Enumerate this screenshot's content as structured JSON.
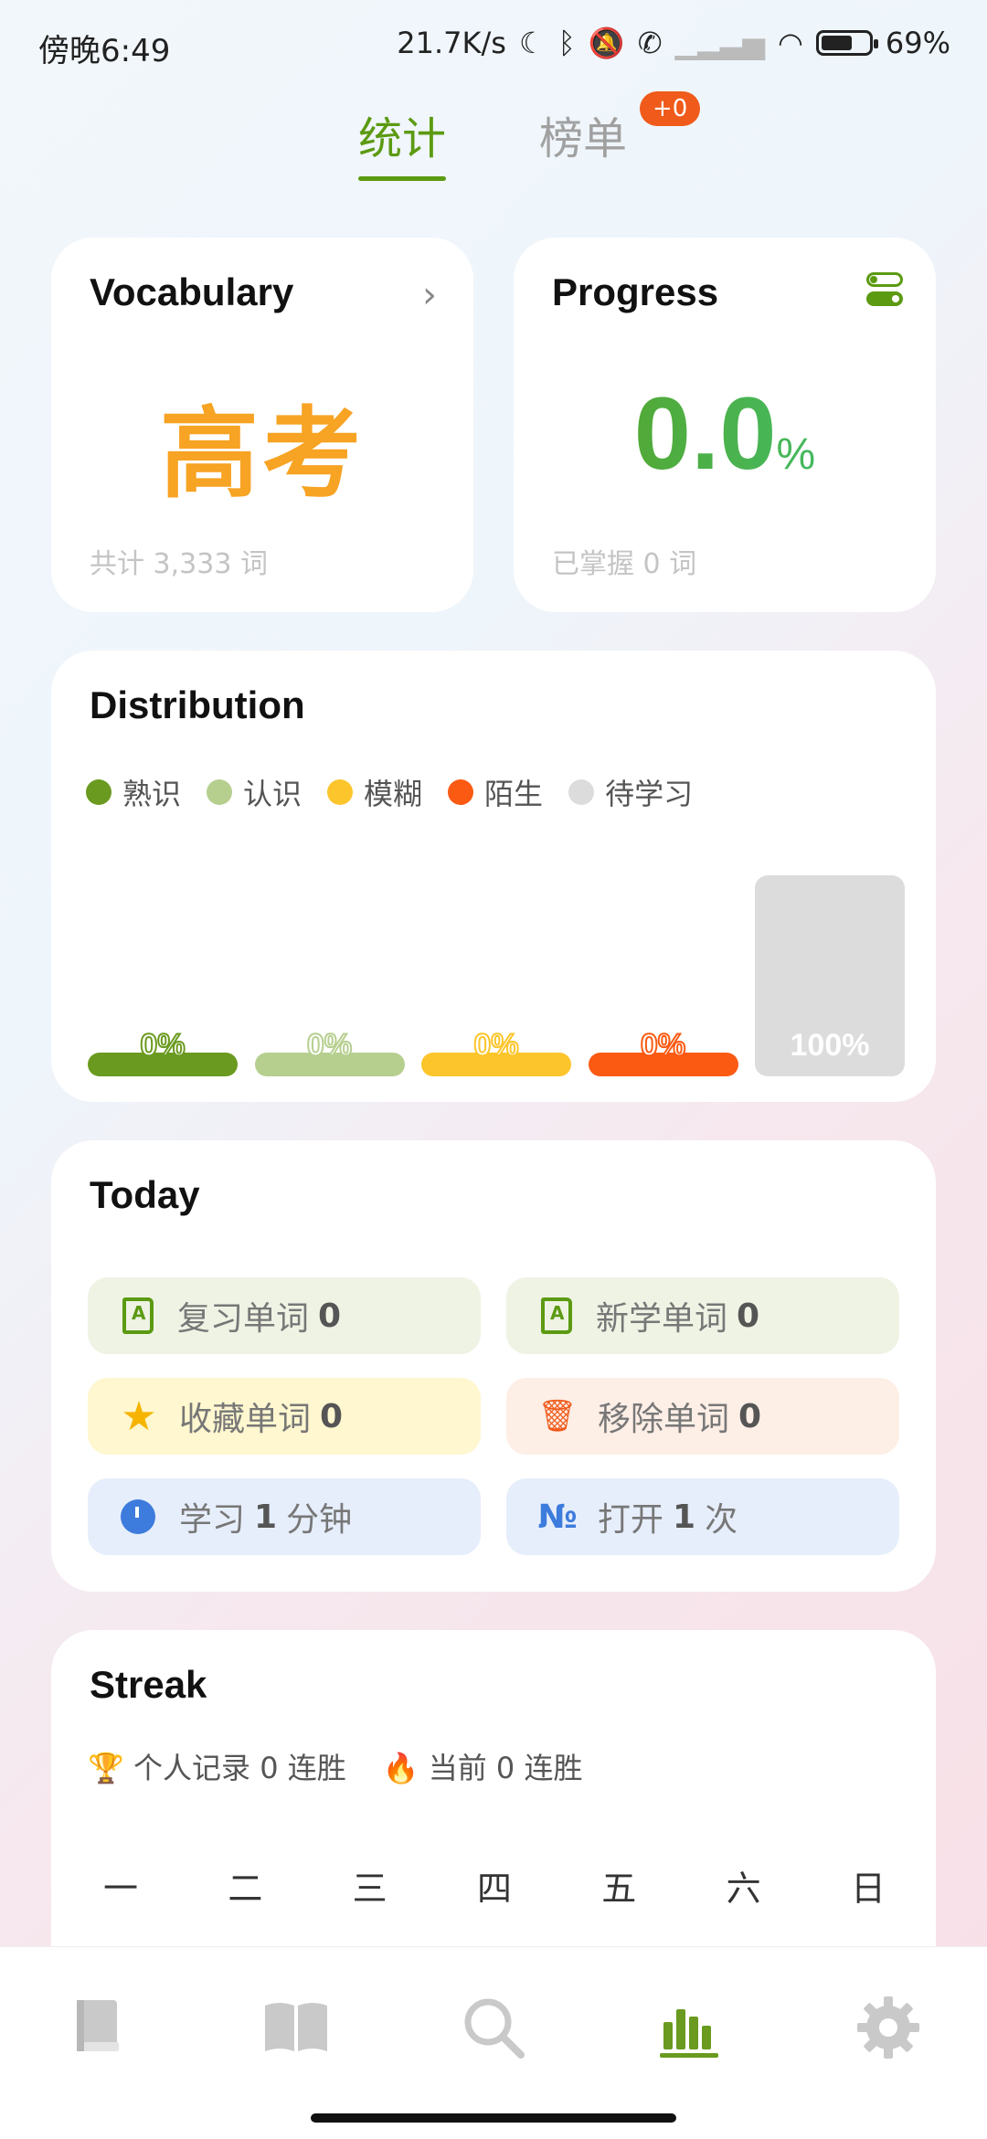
{
  "status_bar": {
    "time": "傍晚6:49",
    "network_speed": "21.7K/s",
    "battery": "69%"
  },
  "tabs": [
    {
      "label": "统计",
      "active": true
    },
    {
      "label": "榜单",
      "active": false,
      "badge": "+0"
    }
  ],
  "vocabulary": {
    "title": "Vocabulary",
    "book": "高考",
    "total": "共计 3,333 词"
  },
  "progress": {
    "title": "Progress",
    "value": "0.0",
    "unit": "%",
    "mastered": "已掌握 0 词"
  },
  "distribution": {
    "title": "Distribution",
    "legend": [
      {
        "label": "熟识",
        "color": "#6a9a1f"
      },
      {
        "label": "认识",
        "color": "#b6cf8f"
      },
      {
        "label": "模糊",
        "color": "#fcc52b"
      },
      {
        "label": "陌生",
        "color": "#fb5a12"
      },
      {
        "label": "待学习",
        "color": "#dcdcdc"
      }
    ],
    "bars": [
      {
        "label": "0%",
        "value": 0
      },
      {
        "label": "0%",
        "value": 0
      },
      {
        "label": "0%",
        "value": 0
      },
      {
        "label": "0%",
        "value": 0
      },
      {
        "label": "100%",
        "value": 100
      }
    ]
  },
  "today": {
    "title": "Today",
    "items": [
      {
        "label": "复习单词",
        "num": "0",
        "icon": "book-icon"
      },
      {
        "label": "新学单词",
        "num": "0",
        "icon": "book-icon"
      },
      {
        "label": "收藏单词",
        "num": "0",
        "icon": "star-icon"
      },
      {
        "label": "移除单词",
        "num": "0",
        "icon": "trash-icon"
      },
      {
        "label": "学习",
        "num": "1",
        "suffix": "分钟",
        "icon": "clock-icon"
      },
      {
        "label": "打开",
        "num": "1",
        "suffix": "次",
        "icon": "number-icon"
      }
    ]
  },
  "streak": {
    "title": "Streak",
    "personal_record": "个人记录 0 连胜",
    "current": "当前 0 连胜",
    "weekdays": [
      "一",
      "二",
      "三",
      "四",
      "五",
      "六",
      "日"
    ]
  },
  "nav": [
    "book-icon",
    "open-book-icon",
    "search-icon",
    "stats-icon",
    "gear-icon"
  ]
}
